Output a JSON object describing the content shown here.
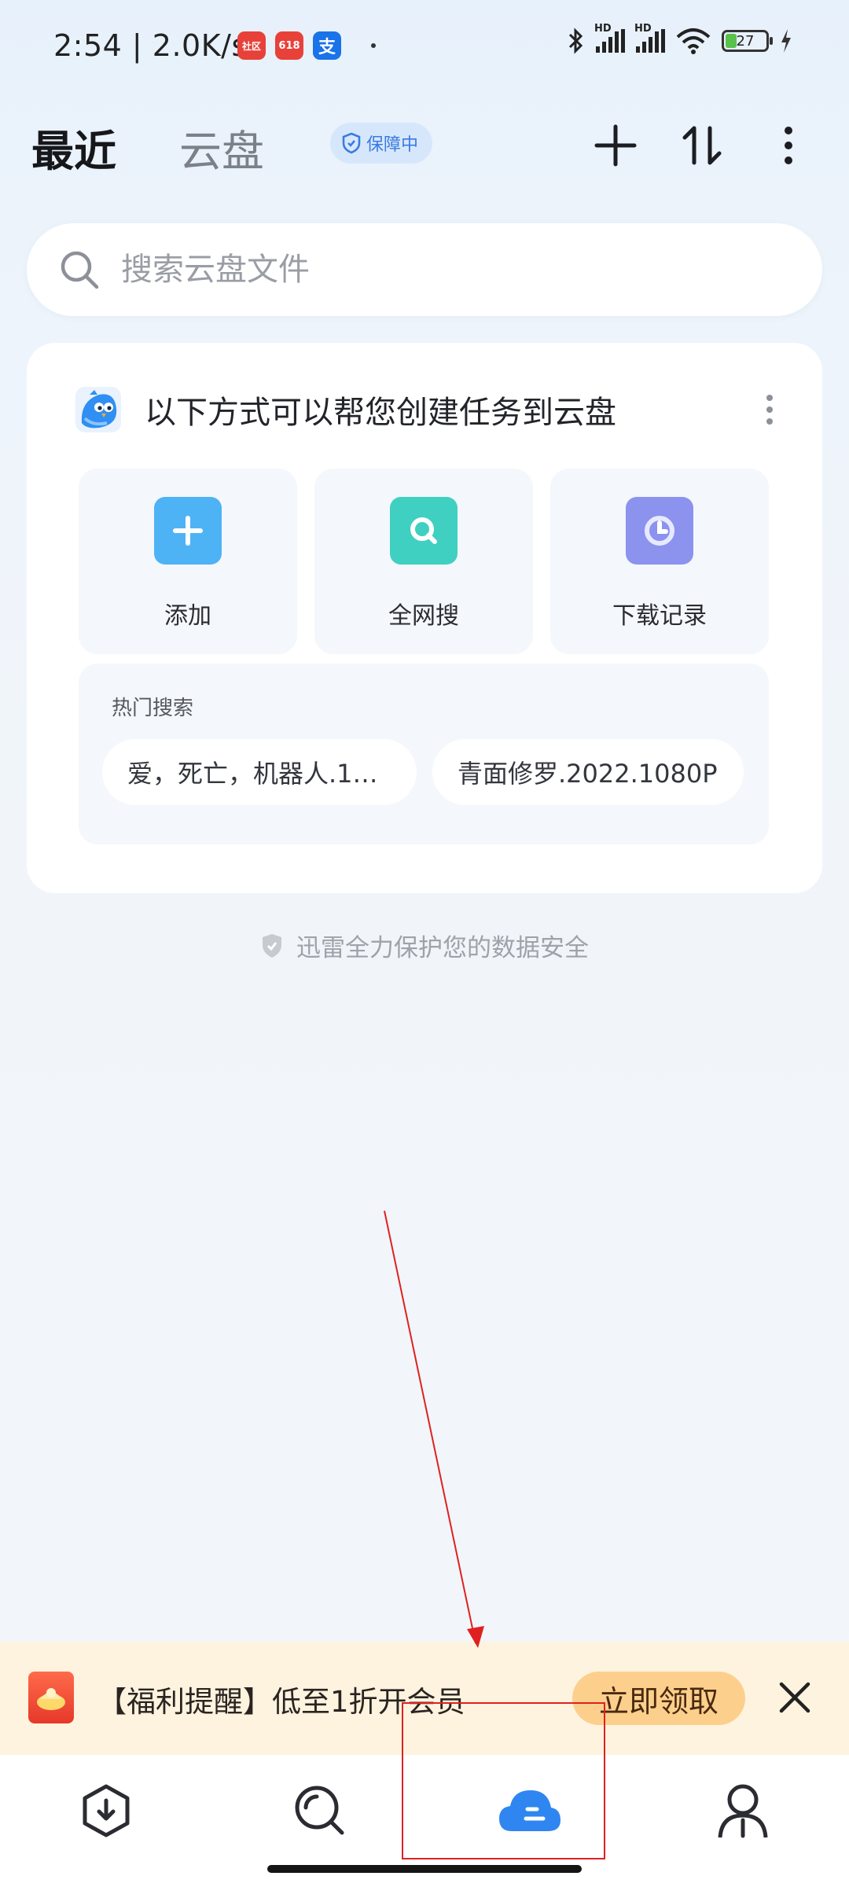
{
  "status_bar": {
    "time_speed": "2:54 | 2.0K/s",
    "apps": [
      {
        "name": "社区",
        "color": "#e8413a"
      },
      {
        "name": "618",
        "color": "#e8413a"
      },
      {
        "name": "支",
        "color": "#1a73e8"
      }
    ],
    "battery": "27",
    "hd_label": "HD"
  },
  "header": {
    "tab_recent": "最近",
    "tab_cloud": "云盘",
    "badge": "保障中"
  },
  "search": {
    "placeholder": "搜索云盘文件"
  },
  "card": {
    "title": "以下方式可以帮您创建任务到云盘",
    "actions": [
      {
        "label": "添加",
        "color": "#4db3f5"
      },
      {
        "label": "全网搜",
        "color": "#3fd0c1"
      },
      {
        "label": "下载记录",
        "color": "#8b93ee"
      }
    ],
    "hot_title": "热门搜索",
    "hot_chips": [
      "爱，死亡，机器人.10...",
      "青面修罗.2022.1080P"
    ]
  },
  "security_note": "迅雷全力保护您的数据安全",
  "promo": {
    "text": "【福利提醒】低至1折开会员",
    "button": "立即领取"
  },
  "colors": {
    "accent": "#2f86f0",
    "annotation": "#e02020"
  }
}
